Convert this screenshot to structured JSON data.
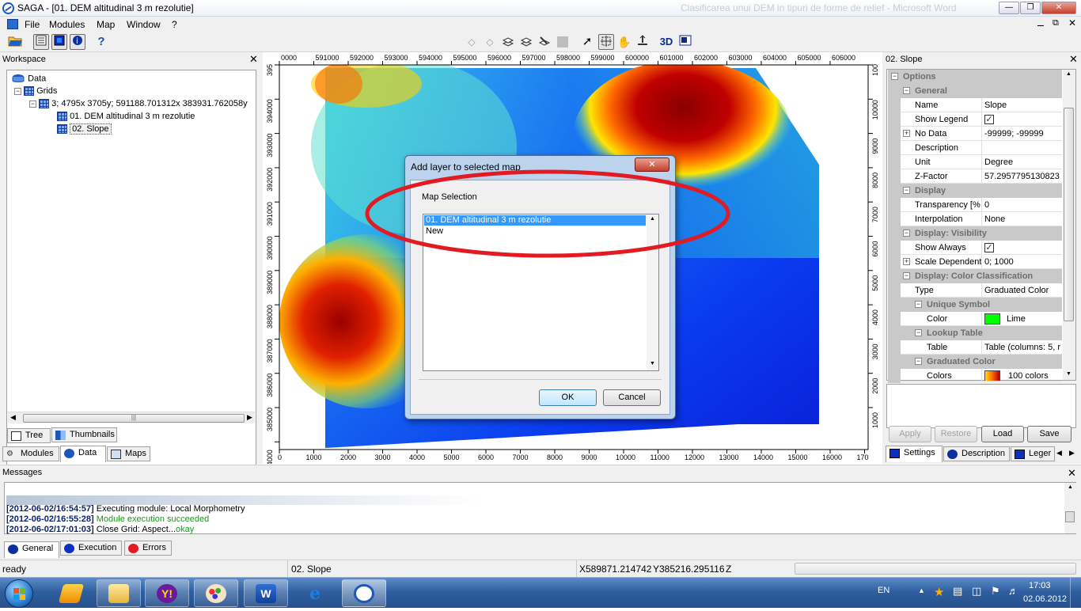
{
  "window": {
    "app_title": "SAGA - [01. DEM altitudinal 3 m rezolutie]",
    "faded_title": "Clasificarea unui DEM in tipuri de forme de relief - Microsoft Word"
  },
  "menu": {
    "file": "File",
    "modules": "Modules",
    "map": "Map",
    "window": "Window",
    "help": "?"
  },
  "workspace": {
    "title": "Workspace",
    "tree": {
      "data": "Data",
      "grids": "Grids",
      "system": "3; 4795x 3705y; 591188.701312x 383931.762058y",
      "layer1": "01. DEM altitudinal 3 m rezolutie",
      "layer2": "02. Slope"
    },
    "view_tabs": {
      "tree": "Tree",
      "thumbnails": "Thumbnails"
    },
    "tabs": {
      "modules": "Modules",
      "data": "Data",
      "maps": "Maps"
    }
  },
  "map": {
    "x_top_ticks": [
      "0000",
      "591000",
      "592000",
      "593000",
      "594000",
      "595000",
      "596000",
      "597000",
      "598000",
      "599000",
      "600000",
      "601000",
      "602000",
      "603000",
      "604000",
      "605000",
      "606000"
    ],
    "x_bottom_ticks": [
      "0",
      "1000",
      "2000",
      "3000",
      "4000",
      "5000",
      "6000",
      "7000",
      "8000",
      "9000",
      "10000",
      "11000",
      "12000",
      "13000",
      "14000",
      "15000",
      "16000",
      "170"
    ],
    "y_left_ticks": [
      "395",
      "394000",
      "393000",
      "392000",
      "391000",
      "390000",
      "389000",
      "388000",
      "387000",
      "386000",
      "385000",
      "4000"
    ],
    "y_right_ticks": [
      "100",
      "10000",
      "9000",
      "8000",
      "7000",
      "6000",
      "5000",
      "4000",
      "3000",
      "2000",
      "1000"
    ]
  },
  "dialog": {
    "title": "Add layer to selected map",
    "group_label": "Map Selection",
    "items": [
      "01. DEM altitudinal 3 m rezolutie",
      "New"
    ],
    "ok": "OK",
    "cancel": "Cancel"
  },
  "properties": {
    "title": "02. Slope",
    "options": "Options",
    "general": "General",
    "name_k": "Name",
    "name_v": "Slope",
    "legend_k": "Show Legend",
    "nodata_k": "No Data",
    "nodata_v": "-99999; -99999",
    "desc_k": "Description",
    "unit_k": "Unit",
    "unit_v": "Degree",
    "zf_k": "Z-Factor",
    "zf_v": "57.2957795130823",
    "display": "Display",
    "transp_k": "Transparency [%",
    "transp_v": "0",
    "interp_k": "Interpolation",
    "interp_v": "None",
    "visibility": "Display: Visibility",
    "showalways_k": "Show Always",
    "scaledep_k": "Scale Dependent",
    "scaledep_v": "0; 1000",
    "colorclass": "Display: Color Classification",
    "type_k": "Type",
    "type_v": "Graduated Color",
    "unique": "Unique Symbol",
    "color_k": "Color",
    "color_v": "Lime",
    "lookup": "Lookup Table",
    "table_k": "Table",
    "table_v": "Table (columns: 5, r",
    "graduated": "Graduated Color",
    "colors_k": "Colors",
    "colors_v": "100 colors",
    "buttons": {
      "apply": "Apply",
      "restore": "Restore",
      "load": "Load",
      "save": "Save"
    },
    "tabs": {
      "settings": "Settings",
      "description": "Description",
      "legend": "Leger"
    }
  },
  "messages": {
    "title": "Messages",
    "lines": [
      {
        "ts": "[2012-06-02/16:54:57]",
        "text": "Executing module: Local Morphometry",
        "suffix": ""
      },
      {
        "ts": "[2012-06-02/16:55:28]",
        "text": "Module execution succeeded",
        "suffix": ""
      },
      {
        "ts": "[2012-06-02/17:01:03]",
        "text": "Close Grid: Aspect...",
        "suffix": "okay"
      }
    ],
    "tabs": {
      "general": "General",
      "execution": "Execution",
      "errors": "Errors"
    }
  },
  "status": {
    "ready": "ready",
    "layer": "02. Slope",
    "x": "X589871.214742",
    "y": "Y385216.295116",
    "z": "Z"
  },
  "taskbar": {
    "lang": "EN",
    "time": "17:03",
    "date": "02.06.2012"
  },
  "colors": {
    "accent": "#0a246a",
    "selection": "#3399ff",
    "success": "#1a9a1a",
    "lime": "#00ff00",
    "ellipse": "#e21b23"
  }
}
